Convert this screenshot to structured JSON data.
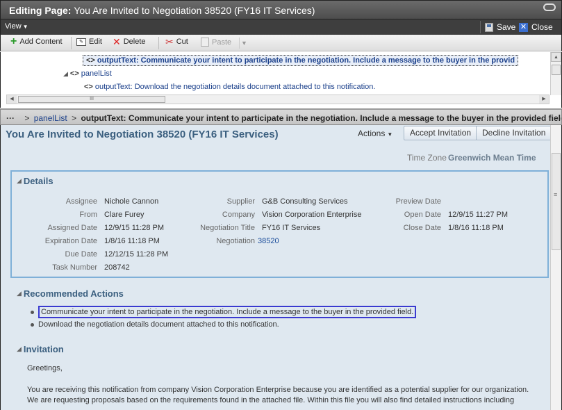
{
  "window": {
    "title_prefix": "Editing Page:",
    "title_page": "You Are Invited to Negotiation 38520 (FY16 IT Services)"
  },
  "viewbar": {
    "view_label": "View",
    "save_label": "Save",
    "close_label": "Close"
  },
  "toolbar": {
    "add_content": "Add Content",
    "edit": "Edit",
    "delete": "Delete",
    "cut": "Cut",
    "paste": "Paste"
  },
  "tree": {
    "row1": "outputText: Communicate your intent to participate in the negotiation. Include a message to the buyer in the provid",
    "row2": "panelList",
    "row3": "outputText: Download the negotiation details document attached to this notification.",
    "scroll_thumb": "III"
  },
  "breadcrumb": {
    "ellipsis": "···",
    "parent": "panelList",
    "separator_1": ">",
    "separator_2": ">",
    "current": "outputText: Communicate your intent to participate in the negotiation. Include a message to the buyer in the provided field."
  },
  "main": {
    "title": "You Are Invited to Negotiation 38520 (FY16 IT Services)",
    "actions_label": "Actions",
    "accept_label": "Accept Invitation",
    "decline_label": "Decline Invitation",
    "timezone_label": "Time Zone",
    "timezone_value": "Greenwich Mean Time"
  },
  "details": {
    "title": "Details",
    "col1": [
      {
        "label": "Assignee",
        "value": "Nichole Cannon"
      },
      {
        "label": "From",
        "value": "Clare Furey"
      },
      {
        "label": "Assigned Date",
        "value": "12/9/15 11:28 PM"
      },
      {
        "label": "Expiration Date",
        "value": "1/8/16 11:18 PM"
      },
      {
        "label": "Due Date",
        "value": "12/12/15 11:28 PM"
      },
      {
        "label": "Task Number",
        "value": "208742"
      }
    ],
    "col2": [
      {
        "label": "Supplier",
        "value": "G&B Consulting Services"
      },
      {
        "label": "Company",
        "value": "Vision Corporation Enterprise"
      },
      {
        "label": "Negotiation Title",
        "value": "FY16 IT Services"
      },
      {
        "label": "Negotiation",
        "value": "38520"
      }
    ],
    "col3": [
      {
        "label": "Preview Date",
        "value": ""
      },
      {
        "label": "Open Date",
        "value": "12/9/15 11:27 PM"
      },
      {
        "label": "Close Date",
        "value": "1/8/16 11:18 PM"
      }
    ]
  },
  "recommended": {
    "title": "Recommended Actions",
    "items": [
      "Communicate your intent to participate in the negotiation. Include a message to the buyer in the provided field.",
      "Download the negotiation details document attached to this notification."
    ]
  },
  "invitation": {
    "title": "Invitation",
    "greeting": "Greetings,",
    "line1": "You are receiving this notification from company Vision Corporation Enterprise because you are identified as a potential supplier for our organization.",
    "line2": "We are requesting proposals based on the requirements found in the attached file. Within this file you will also find detailed instructions including"
  }
}
